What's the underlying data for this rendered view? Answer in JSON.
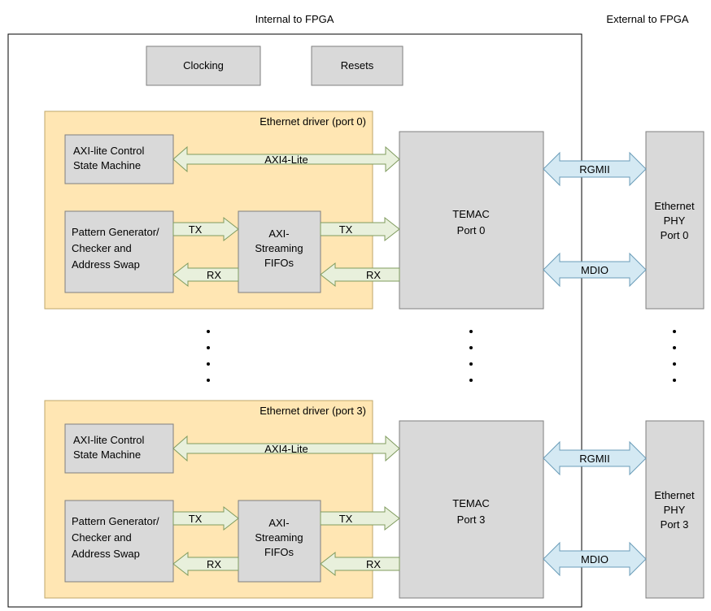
{
  "labels": {
    "internal": "Internal to FPGA",
    "external": "External to FPGA",
    "clocking": "Clocking",
    "resets": "Resets",
    "driver0_title": "Ethernet driver (port 0)",
    "driver3_title": "Ethernet driver (port 3)",
    "axi_lite_ctrl_l1": "AXI-lite Control",
    "axi_lite_ctrl_l2": "State Machine",
    "patgen_l1": "Pattern Generator/",
    "patgen_l2": "Checker and",
    "patgen_l3": "Address Swap",
    "fifo_l1": "AXI-",
    "fifo_l2": "Streaming",
    "fifo_l3": "FIFOs",
    "axi4lite": "AXI4-Lite",
    "tx": "TX",
    "rx": "RX",
    "temac": "TEMAC",
    "port0": "Port 0",
    "port3": "Port 3",
    "rgmii": "RGMII",
    "mdio": "MDIO",
    "phy_l1": "Ethernet",
    "phy_l2": "PHY"
  }
}
